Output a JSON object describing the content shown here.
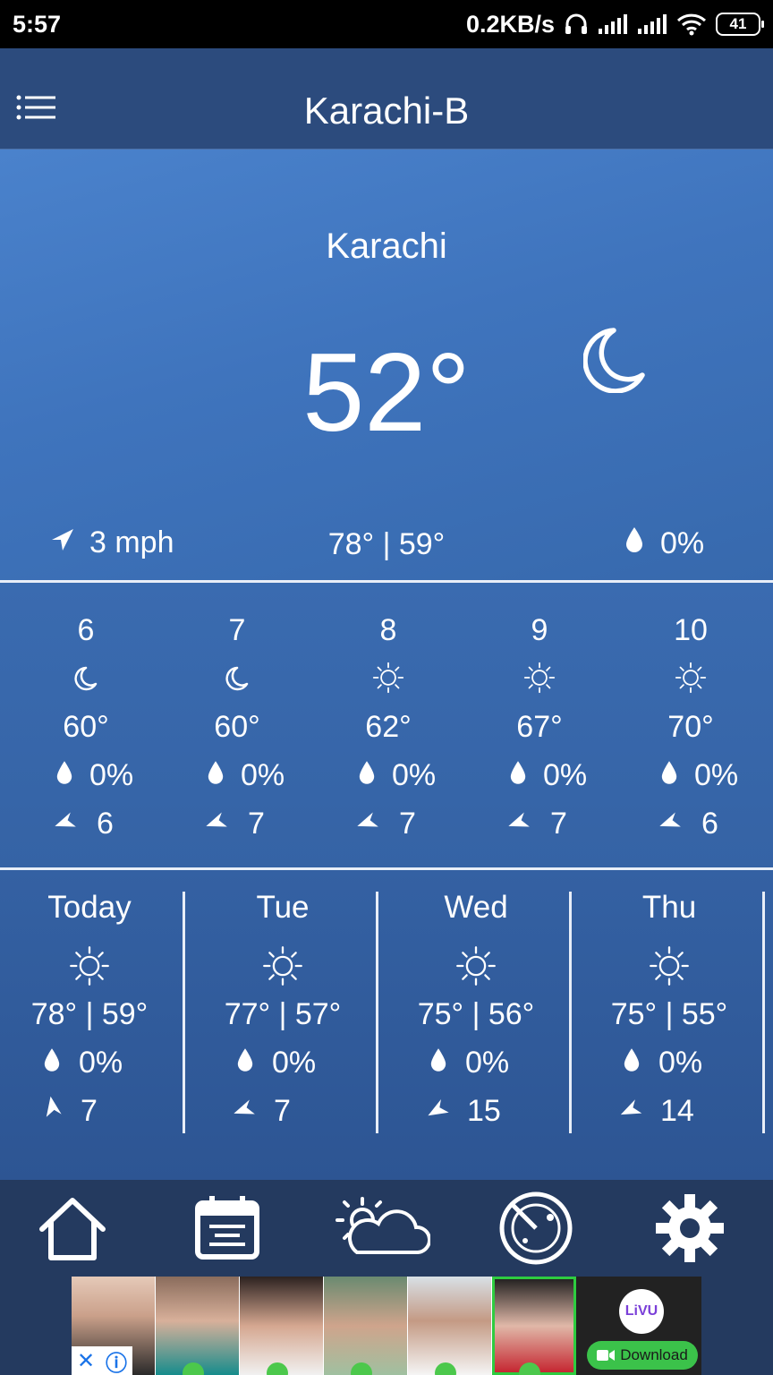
{
  "status_bar": {
    "time": "5:57",
    "net_speed": "0.2KB/s",
    "battery": "41"
  },
  "app_bar": {
    "title": "Karachi-B"
  },
  "current": {
    "city": "Karachi",
    "temperature": "52°",
    "condition_icon": "moon-icon",
    "wind": "3 mph",
    "high_low": "78° | 59°",
    "precip": "0%"
  },
  "hourly": [
    {
      "hour": "6",
      "icon": "moon-icon",
      "temp": "60°",
      "precip": "0%",
      "wind": "6"
    },
    {
      "hour": "7",
      "icon": "moon-icon",
      "temp": "60°",
      "precip": "0%",
      "wind": "7"
    },
    {
      "hour": "8",
      "icon": "sun-icon",
      "temp": "62°",
      "precip": "0%",
      "wind": "7"
    },
    {
      "hour": "9",
      "icon": "sun-icon",
      "temp": "67°",
      "precip": "0%",
      "wind": "7"
    },
    {
      "hour": "10",
      "icon": "sun-icon",
      "temp": "70°",
      "precip": "0%",
      "wind": "6"
    }
  ],
  "daily": [
    {
      "day": "Today",
      "icon": "sun-icon",
      "high_low": "78° | 59°",
      "precip": "0%",
      "wind": "7"
    },
    {
      "day": "Tue",
      "icon": "sun-icon",
      "high_low": "77° | 57°",
      "precip": "0%",
      "wind": "7"
    },
    {
      "day": "Wed",
      "icon": "sun-icon",
      "high_low": "75° | 56°",
      "precip": "0%",
      "wind": "15"
    },
    {
      "day": "Thu",
      "icon": "sun-icon",
      "high_low": "75° | 55°",
      "precip": "0%",
      "wind": "14"
    }
  ],
  "bottom_nav": {
    "items": [
      "home-icon",
      "calendar-icon",
      "partly-cloudy-icon",
      "radar-icon",
      "settings-gear-icon"
    ]
  },
  "ad": {
    "brand": "LiVU",
    "cta": "Download"
  },
  "colors": {
    "app_bar": "#2c4b7d",
    "hero_top": "#4a82cc",
    "panel": "#3563a5",
    "bottom_nav": "#243a5f",
    "ad_cta": "#3bc24a"
  }
}
